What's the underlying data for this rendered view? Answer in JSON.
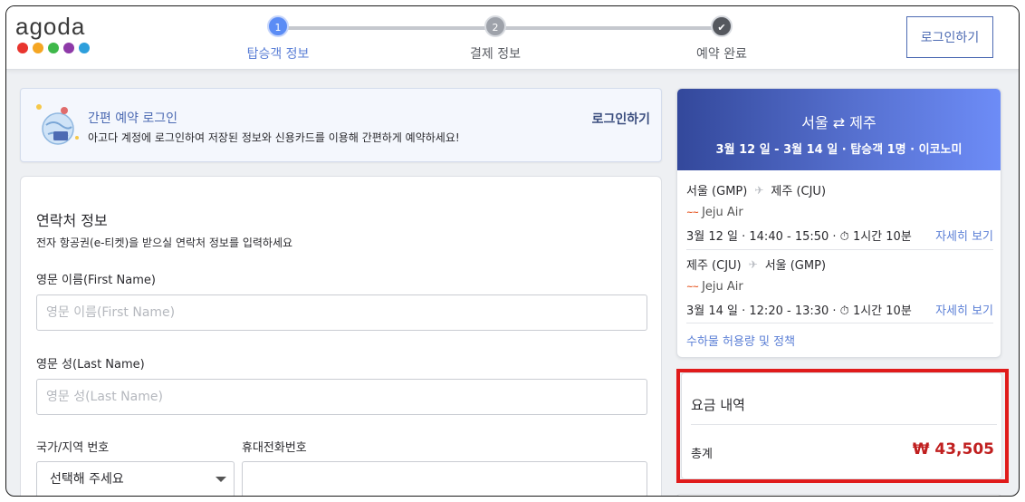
{
  "brand": {
    "name": "agoda",
    "dot_colors": [
      "#e8352e",
      "#f5a623",
      "#3fb84a",
      "#8e3aa8",
      "#2d9fdc"
    ]
  },
  "steps": [
    {
      "number": "1",
      "label": "탑승객 정보",
      "state": "active"
    },
    {
      "number": "2",
      "label": "결제 정보",
      "state": "pending"
    },
    {
      "number": "",
      "label": "예약 완료",
      "state": "done"
    }
  ],
  "header": {
    "login_label": "로그인하기"
  },
  "banner": {
    "title": "간편 예약 로그인",
    "description": "아고다 계정에 로그인하여 저장된 정보와 신용카드를 이용해 간편하게 예약하세요!",
    "login_label": "로그인하기"
  },
  "contact_form": {
    "title": "연락처 정보",
    "subtitle": "전자 항공권(e-티켓)을 받으실 연락처 정보를 입력하세요",
    "first_name": {
      "label": "영문 이름(First Name)",
      "placeholder": "영문 이름(First Name)",
      "value": ""
    },
    "last_name": {
      "label": "영문 성(Last Name)",
      "placeholder": "영문 성(Last Name)",
      "value": ""
    },
    "country_code": {
      "label": "국가/지역 번호",
      "selected": "선택해 주세요"
    },
    "phone": {
      "label": "휴대전화번호",
      "value": ""
    }
  },
  "trip": {
    "route_from": "서울",
    "route_to": "제주",
    "route_arrow": "⇄",
    "meta": "3월 12 일 - 3월 14 일 · 탑승객 1명 · 이코노미",
    "segments": [
      {
        "origin": "서울 (GMP)",
        "destination": "제주 (CJU)",
        "airline": "Jeju Air",
        "schedule": "3월 12 일 · 14:40 - 15:50 · ⏱ 1시간 10분",
        "details_label": "자세히 보기"
      },
      {
        "origin": "제주 (CJU)",
        "destination": "서울 (GMP)",
        "airline": "Jeju Air",
        "schedule": "3월 14 일 · 12:20 - 13:30 · ⏱ 1시간 10분",
        "details_label": "자세히 보기"
      }
    ],
    "baggage_link": "수하물 허용량 및 정책"
  },
  "price": {
    "title": "요금 내역",
    "total_label": "총계",
    "total_value": "₩ 43,505",
    "highlight_color": "#e01b1b"
  }
}
